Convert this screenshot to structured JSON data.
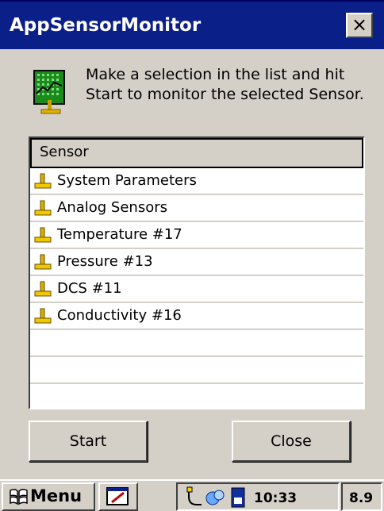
{
  "window": {
    "title": "AppSensorMonitor",
    "close_label": "×"
  },
  "header": {
    "instruction_line1": "Make a selection in the list and hit",
    "instruction_line2": "Start to monitor the selected Sensor."
  },
  "list": {
    "column_header": "Sensor",
    "items": [
      "System Parameters",
      "Analog Sensors",
      "Temperature #17",
      "Pressure #13",
      "DCS #11",
      "Conductivity #16"
    ]
  },
  "buttons": {
    "start": "Start",
    "close": "Close"
  },
  "taskbar": {
    "menu_label": "Menu",
    "time": "10:33",
    "version": "8.9"
  },
  "colors": {
    "title_bar": "#0b1f88",
    "face": "#d4d0c8",
    "icon_green": "#1a8a1a"
  }
}
